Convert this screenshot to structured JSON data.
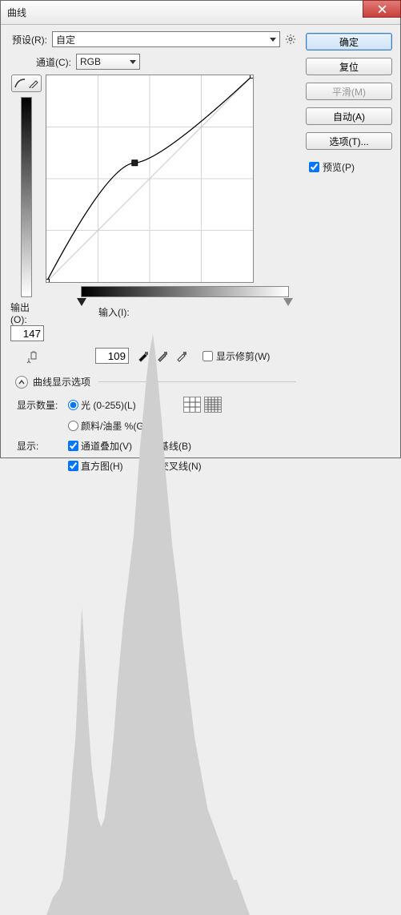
{
  "window": {
    "title": "曲线"
  },
  "buttons": {
    "ok": "确定",
    "reset": "复位",
    "smooth": "平滑(M)",
    "auto": "自动(A)",
    "options": "选项(T)..."
  },
  "preview": {
    "checked": true,
    "label": "预览(P)"
  },
  "preset": {
    "label": "预设(R):",
    "value": "自定"
  },
  "channel": {
    "label": "通道(C):",
    "value": "RGB"
  },
  "output": {
    "label": "输出(O):",
    "value": "147"
  },
  "input": {
    "label": "输入(I):",
    "value": "109"
  },
  "clipping": {
    "label": "显示修剪(W)",
    "checked": false
  },
  "section": {
    "header": "曲线显示选项"
  },
  "showqty": {
    "label": "显示数量:",
    "light": "光 (0-255)(L)",
    "pigment": "颜料/油墨 %(G)",
    "selected": "light"
  },
  "show": {
    "label": "显示:",
    "overlay": {
      "label": "通道叠加(V)",
      "checked": true
    },
    "baseline": {
      "label": "基线(B)",
      "checked": true
    },
    "histogram": {
      "label": "直方图(H)",
      "checked": true
    },
    "intersection": {
      "label": "交叉线(N)",
      "checked": true
    }
  },
  "chart_data": {
    "type": "line",
    "title": "曲线",
    "xlabel": "输入",
    "ylabel": "输出",
    "xlim": [
      0,
      255
    ],
    "ylim": [
      0,
      255
    ],
    "grid": "4x4",
    "points": [
      {
        "x": 0,
        "y": 0,
        "handle": true
      },
      {
        "x": 109,
        "y": 147,
        "handle": true
      },
      {
        "x": 255,
        "y": 255,
        "handle": true
      }
    ],
    "histogram": [
      0,
      2,
      4,
      5,
      6,
      8,
      14,
      22,
      32,
      40,
      56,
      70,
      58,
      44,
      34,
      28,
      22,
      20,
      22,
      28,
      34,
      42,
      52,
      60,
      68,
      74,
      80,
      86,
      96,
      106,
      114,
      122,
      128,
      132,
      126,
      118,
      110,
      100,
      92,
      84,
      78,
      72,
      64,
      58,
      52,
      46,
      40,
      36,
      32,
      28,
      24,
      22,
      20,
      18,
      16,
      14,
      12,
      10,
      8,
      8,
      6,
      4,
      2,
      0
    ]
  }
}
